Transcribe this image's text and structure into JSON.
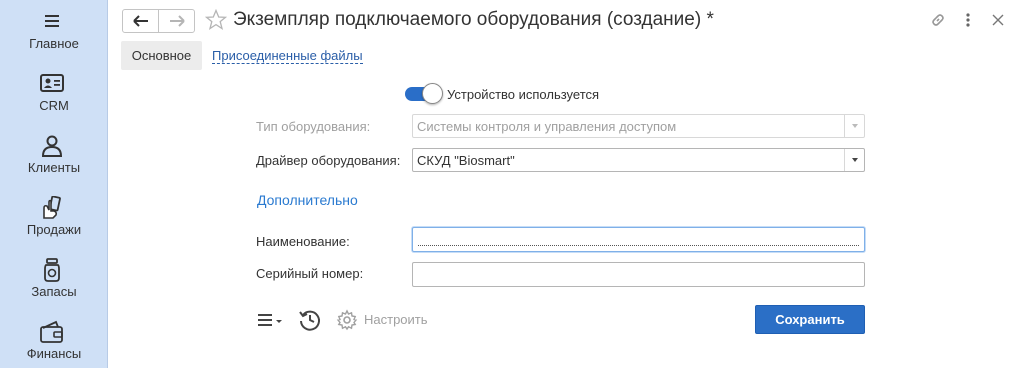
{
  "sidebar": {
    "items": [
      {
        "label": "Главное",
        "icon": "menu-icon"
      },
      {
        "label": "CRM",
        "icon": "contact-card-icon"
      },
      {
        "label": "Клиенты",
        "icon": "person-icon"
      },
      {
        "label": "Продажи",
        "icon": "hand-cards-icon"
      },
      {
        "label": "Запасы",
        "icon": "jar-icon"
      },
      {
        "label": "Финансы",
        "icon": "wallet-icon"
      }
    ]
  },
  "header": {
    "title": "Экземпляр подключаемого оборудования (создание) *"
  },
  "tabs": {
    "main": "Основное",
    "files": "Присоединенные файлы"
  },
  "form": {
    "device_used_label": "Устройство используется",
    "device_used": true,
    "equipment_type_label": "Тип оборудования:",
    "equipment_type_value": "Системы контроля и управления доступом",
    "driver_label": "Драйвер оборудования:",
    "driver_value": "СКУД  \"Biosmart\"",
    "section_title": "Дополнительно",
    "name_label": "Наименование:",
    "name_value": "",
    "serial_label": "Серийный номер:",
    "serial_value": ""
  },
  "toolbar": {
    "settings_label": "Настроить",
    "save_label": "Сохранить"
  },
  "colors": {
    "sidebar_bg": "#cfe0f6",
    "accent": "#2b6fc6",
    "link": "#2a5ea8"
  }
}
